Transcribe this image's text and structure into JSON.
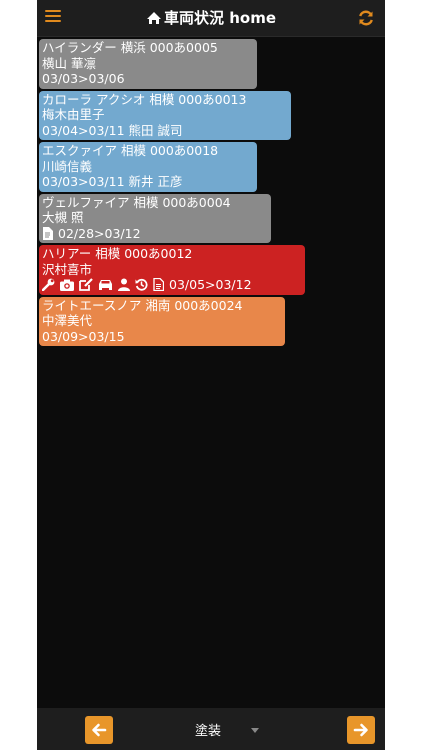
{
  "header": {
    "title": "車両状況 home",
    "menu_icon": "hamburger-menu-icon",
    "refresh_icon": "refresh-icon",
    "accent": "#e08a1e"
  },
  "vehicles": [
    {
      "color": "#8a8a8a",
      "width": 218,
      "l1": "ハイランダー 横浜 000あ0005",
      "l2": "横山 華凛",
      "l3": "03/03>03/06"
    },
    {
      "color": "#73a9cf",
      "width": 252,
      "l1": "カローラ アクシオ 相模 000あ0013",
      "l2": "梅木由里子",
      "l3": "03/04>03/11 熊田 誠司"
    },
    {
      "color": "#73a9cf",
      "width": 218,
      "l1": "エスクァイア 相模 000あ0018",
      "l2": "川崎信義",
      "l3": "03/03>03/11 新井 正彦"
    },
    {
      "color": "#8a8a8a",
      "width": 232,
      "l1": "ヴェルファイア 相模 000あ0004",
      "l2": "大槻 照",
      "l3": "02/28>03/12"
    },
    {
      "color": "#cc2222",
      "width": 266,
      "l1": "ハリアー 相模 000あ0012",
      "l2": "沢村喜市",
      "l3": "03/05>03/12"
    },
    {
      "color": "#e8874a",
      "width": 246,
      "l1": "ライトエースノア 湘南 000あ0024",
      "l2": "中澤美代",
      "l3": "03/09>03/15"
    }
  ],
  "footer": {
    "select_value": "塗装",
    "prev_icon": "arrow-left-icon",
    "next_icon": "arrow-right-icon",
    "button_color": "#e8962a"
  }
}
